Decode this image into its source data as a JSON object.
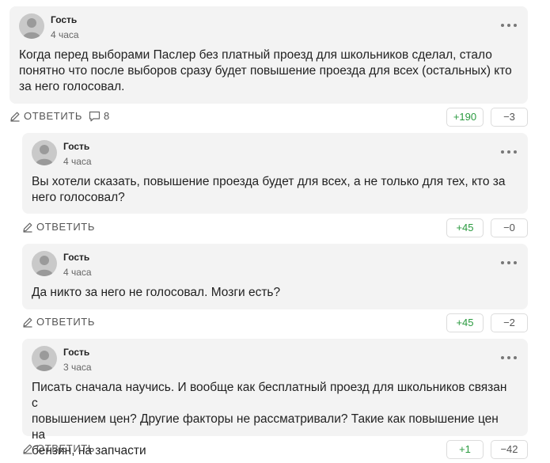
{
  "labels": {
    "reply": "ОТВЕТИТЬ"
  },
  "colors": {
    "upvote": "#2a9a3f",
    "card_bg": "#f3f3f3"
  },
  "comments": [
    {
      "author": "Гость",
      "time": "4 часа",
      "lines": [
        "Когда перед выборами Паслер без платный проезд для школьников сделал, стало",
        "понятно что после выборов сразу будет повышение проезда для всех (остальных) кто",
        "за него голосовал."
      ],
      "replies_count": "8",
      "up": "+190",
      "down": "−3"
    },
    {
      "author": "Гость",
      "time": "4 часа",
      "lines": [
        "Вы хотели сказать, повышение проезда будет для всех, а не только для тех, кто за",
        "него голосовал?"
      ],
      "up": "+45",
      "down": "−0"
    },
    {
      "author": "Гость",
      "time": "4 часа",
      "lines": [
        "Да никто за него не голосовал. Мозги есть?"
      ],
      "up": "+45",
      "down": "−2"
    },
    {
      "author": "Гость",
      "time": "3 часа",
      "lines": [
        "Писать сначала научись. И вообще как бесплатный проезд для школьников связан с",
        "повышением цен? Другие факторы не рассматривали? Такие как повышение цен на",
        "бензин, на запчасти"
      ],
      "up": "+1",
      "down": "−42"
    }
  ]
}
